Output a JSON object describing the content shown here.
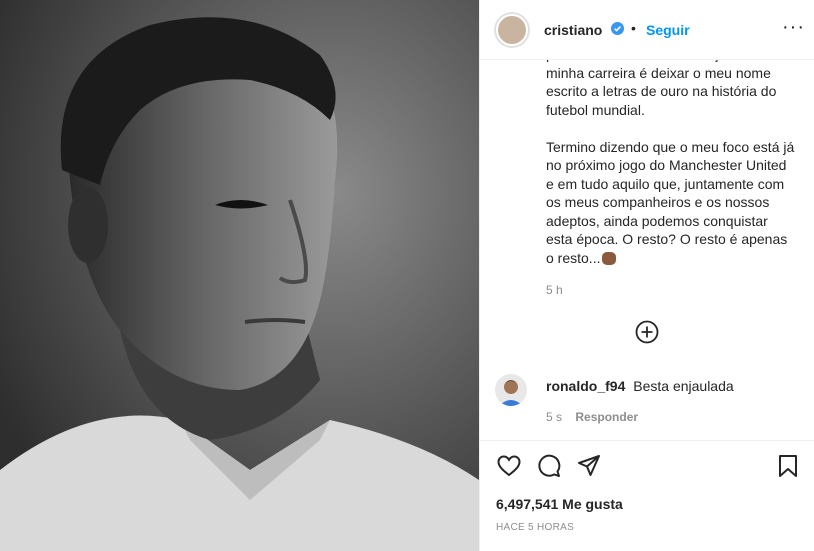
{
  "post": {
    "photo_alt": "Black and white portrait photo",
    "author": {
      "username": "cristiano",
      "follow_label": "Seguir",
      "separator": "•",
      "more": "···"
    },
    "caption": {
      "paragraphs": [
        "profissionais. A maior ambição da minha carreira é deixar o meu nome escrito a letras de ouro na história do futebol mundial.",
        "Termino dizendo que o meu foco está já no próximo jogo do Manchester United e em tudo aquilo que, juntamente com os meus companheiros e os nossos adeptos, ainda podemos conquistar esta época. O resto? O resto é apenas o resto..."
      ],
      "time": "5 h"
    },
    "comments": [
      {
        "username": "ronaldo_f94",
        "text": "Besta enjaulada",
        "time": "5 s",
        "reply_label": "Responder"
      }
    ],
    "likes": "6,497,541 Me gusta",
    "posted": "HACE 5 HORAS",
    "icons": {
      "like": "heart-icon",
      "comment": "comment-icon",
      "share": "share-icon",
      "save": "bookmark-icon",
      "load_more": "plus-circle-icon",
      "verified": "verified-badge-icon"
    },
    "colors": {
      "link": "#0095f6",
      "text": "#262626",
      "muted": "#8e8e8e",
      "verified": "#3897f0"
    }
  }
}
